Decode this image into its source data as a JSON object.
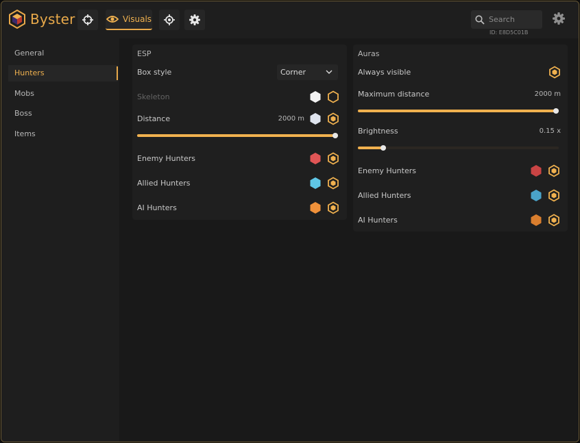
{
  "app": {
    "name": "Byster",
    "user_id": "ID: E8D5C01B"
  },
  "toolbar": {
    "tabs": [
      {
        "name": "crosshair",
        "label": ""
      },
      {
        "name": "visuals",
        "label": "Visuals"
      },
      {
        "name": "target",
        "label": ""
      },
      {
        "name": "settings",
        "label": ""
      }
    ],
    "search_placeholder": "Search"
  },
  "sidebar": {
    "items": [
      {
        "label": "General"
      },
      {
        "label": "Hunters",
        "active": true
      },
      {
        "label": "Mobs"
      },
      {
        "label": "Boss"
      },
      {
        "label": "Items"
      }
    ]
  },
  "esp": {
    "title": "ESP",
    "box_style_label": "Box style",
    "box_style_value": "Corner",
    "skeleton_label": "Skeleton",
    "distance_label": "Distance",
    "distance_value": "2000 m",
    "distance_fraction": 1.0,
    "enemy_label": "Enemy Hunters",
    "allied_label": "Allied Hunters",
    "ai_label": "AI Hunters"
  },
  "auras": {
    "title": "Auras",
    "always_visible_label": "Always visible",
    "max_distance_label": "Maximum distance",
    "max_distance_value": "2000 m",
    "max_distance_fraction": 1.0,
    "brightness_label": "Brightness",
    "brightness_value": "0.15 x",
    "brightness_fraction": 0.14,
    "enemy_label": "Enemy Hunters",
    "allied_label": "Allied Hunters",
    "ai_label": "AI Hunters"
  },
  "colors": {
    "accent": "#f0b14f",
    "enemy": "#e05555",
    "allied": "#5fc7e6",
    "ai": "#f0913a",
    "white": "#f2f2f2",
    "enemy_aura": "#c94444",
    "allied_aura": "#4aa3c9",
    "ai_aura": "#d97e2e"
  }
}
